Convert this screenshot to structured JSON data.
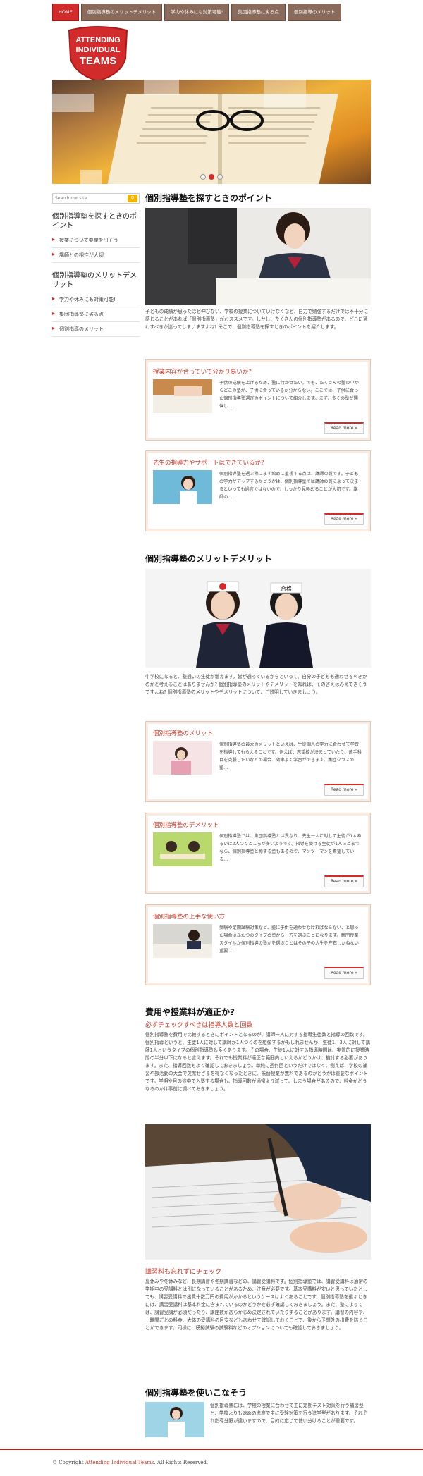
{
  "nav": {
    "items": [
      {
        "label": "HOME",
        "active": true
      },
      {
        "label": "個別指導塾のメリットデメリット"
      },
      {
        "label": "学力や休みにも対策可能!"
      },
      {
        "label": "集団指導塾に劣る点"
      },
      {
        "label": "個別指導のメリット"
      }
    ]
  },
  "logo": {
    "line1": "ATTENDING",
    "line2": "INDIVIDUAL",
    "line3": "TEAMS"
  },
  "hero": {
    "slides": 3,
    "active_slide": 2
  },
  "sidebar": {
    "search_placeholder": "Search our site",
    "sections": [
      {
        "title": "個別指導塾を探すときのポイント",
        "items": [
          "授業について要望を出そう",
          "講師との相性が大切"
        ]
      },
      {
        "title": "個別指導塾のメリットデメリット",
        "items": [
          "学力や休みにも対策可能!",
          "集団指導塾に劣る点",
          "個別指導のメリット"
        ]
      }
    ]
  },
  "main": {
    "s1": {
      "title": "個別指導塾を探すときのポイント",
      "intro": "子どもの成績が思ったほど伸びない、学校の授業についていけなくなど、自力で勉強するだけでは不十分に感じることがあれば「個別指導塾」がおススメです。しかし、たくさんの個別指導塾があるので、どこに通わすべきか迷ってしまいますよね? そこで、個別指導塾を探すときのポイントを紹介します。",
      "cards": [
        {
          "title": "授業内容が合っていて分かり易いか?",
          "text": "子供の成績を上げるため、塾に行かせたい。でも、たくさんの塾の中からどこの塾が、子供に合っているか分からない。ここでは、子供に合った個別指導塾選びのポイントについて紹介します。まず、多くの塾が開催し…",
          "more": "Read more »"
        },
        {
          "title": "先生の指導力やサポートはできているか?",
          "text": "個別指導塾を選ぶ際にまず始めに重視する点は、講師の質です。子どもの学力がアップするかどうかは、個別指導塾では講師の質によって決まるといっても過言ではないので、しっかり見極めることが大切です。講師の…",
          "more": "Read more »"
        }
      ]
    },
    "s2": {
      "title": "個別指導塾のメリットデメリット",
      "badge1": "合格",
      "badge2": "合格",
      "intro": "中学校になると、塾通いの生徒が増えます。皆が通っているからといって、自分の子どもも通わせるべきかのかと考えることはありませんか? 個別指導塾のメリットやデメリットを知れば、その答えはみえてきそうですよね? 個別指導塾のメリットやデメリットについて、ご説明していきましょう。",
      "cards": [
        {
          "title": "個別指導塾のメリット",
          "text": "個別指導塾の最大のメリットといえば、生徒個人の学力に合わせて学習を指導してもらえることです。例えば、志望校が決まっていたり、苦手科目を克服したいなどの場合、効率よく学習ができます。集団クラスの塾…",
          "more": "Read more »"
        },
        {
          "title": "個別指導塾のデメリット",
          "text": "個別指導塾では、集団指導塾とは異なり、先生一人に対して生徒が1人あるいは2人つくところが多いようです。指導を受ける生徒が1人ほどまでなら、個別指導塾と称する塾もあるので、マンツーマンを希望している…",
          "more": "Read more »"
        },
        {
          "title": "個別指導塾の上手な使い方",
          "text": "受験や定期試験対策など、塾に子供を通わせなければならない、と思った場合はふたつのタイプの塾から一方を選ぶことになります。集団授業スタイルか個別指導の塾かを選ぶことはその子の人生を左右しかねない重要…",
          "more": "Read more »"
        }
      ]
    },
    "s3": {
      "title": "費用や授業料が適正か?",
      "subtitle": "必ずチェックすべきは指導人数と回数",
      "body1": "個別指導塾を費用で比較するときにポイントとなるのが、講師一人に対する指導生徒数と指導の回数です。個別指導というと、生徒1人に対して講師が1人つくのを想像するかもしれませんが、生徒1、3人に対して講師1人というタイプの個別指導塾も多くあります。その場合、生徒1人に対する指導時間は、実質的に授業時間の半分以下になると言えます。それでも授業料が適正な範囲内といえるかどうかは、検討する必要があります。また、指導回数もよく確認しておきましょう。単純に週何回というだけではなく、例えば、学校の補習や部活動の大会で欠席せざるを得なくなったときに、振替授業が無料であるのかどうかは重要なポイントです。学期や月の途中で入塾する場合も、指導回数が通常より減って、しまう場合があるので、料金がどうなるのかは事前に調べておきましょう。",
      "subtitle2": "講習料も忘れずにチェック",
      "body2": "夏休みや冬休みなど、長期講習や冬期講習などの、講習受講料です。個別指導塾では、講習受講料は通常の学期中の受講料とは別になっていることがあるため、注意が必要です。基本受講料が安いと思っていたとしても、講習受講料で出費十数万円の費用がかかるというケースはよくあることです。個別指導塾を選ぶときには、講習受講料は基本料金に含まれているのかどうかを必ず確認しておきましょう。また、塾によっては、講習受講が必須だったり、講座数があらかじめ決定されていたりすることがあります。講習の内容や、一時間ごとの料金、大体の受講料の目安などもあわせて確認しておくことで、後から予想外の出費を防ぐことができます。同様に、模擬試験の試験料などのオプションについても確認しておきましょう。"
    },
    "s4": {
      "title": "個別指導塾を使いこなそう",
      "text": "個別指導塾には、学校の授業に合わせて主に定期テスト対策を行う補習型と、学校よりも速めの進度で主に受験対策を行う進学型があります。それぞれ指導分野が違いますので、目的に応じて使い分けることが重要です。"
    }
  },
  "footer": {
    "prefix": "© Copyright ",
    "brand": "Attending Individual Teams",
    "suffix": ". All Rights Reserved."
  },
  "colors": {
    "accent": "#d22b2b",
    "nav": "#8a6a5a"
  }
}
